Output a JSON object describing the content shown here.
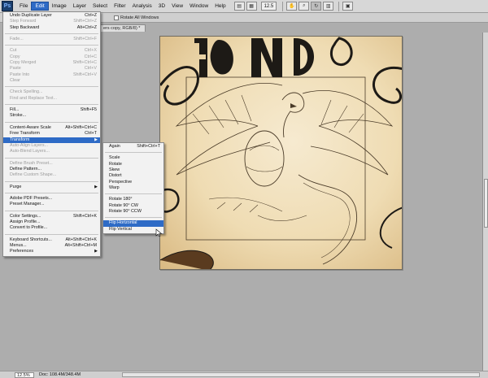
{
  "menubar": {
    "logo": "Ps",
    "items": [
      "File",
      "Edit",
      "Image",
      "Layer",
      "Select",
      "Filter",
      "Analysis",
      "3D",
      "View",
      "Window",
      "Help"
    ],
    "zoom": "12.5"
  },
  "options": {
    "rotate_all_windows": "Rotate All Windows"
  },
  "doc_tab": {
    "title": "ers copy, RGB/8) *"
  },
  "status": {
    "zoom": "12.5%",
    "doc_info": "Doc: 108.4M/348.4M"
  },
  "edit_menu": {
    "rows": [
      {
        "label": "Undo Duplicate Layer",
        "shortcut": "Ctrl+Z",
        "disabled": false
      },
      {
        "label": "Step Forward",
        "shortcut": "Shift+Ctrl+Z",
        "disabled": true
      },
      {
        "label": "Step Backward",
        "shortcut": "Alt+Ctrl+Z",
        "disabled": false
      },
      {
        "sep": true
      },
      {
        "label": "Fade...",
        "shortcut": "Shift+Ctrl+F",
        "disabled": true
      },
      {
        "sep": true
      },
      {
        "label": "Cut",
        "shortcut": "Ctrl+X",
        "disabled": true
      },
      {
        "label": "Copy",
        "shortcut": "Ctrl+C",
        "disabled": true
      },
      {
        "label": "Copy Merged",
        "shortcut": "Shift+Ctrl+C",
        "disabled": true
      },
      {
        "label": "Paste",
        "shortcut": "Ctrl+V",
        "disabled": true
      },
      {
        "label": "Paste Into",
        "shortcut": "Shift+Ctrl+V",
        "disabled": true
      },
      {
        "label": "Clear",
        "shortcut": "",
        "disabled": true
      },
      {
        "sep": true
      },
      {
        "label": "Check Spelling...",
        "shortcut": "",
        "disabled": true
      },
      {
        "label": "Find and Replace Text...",
        "shortcut": "",
        "disabled": true
      },
      {
        "sep": true
      },
      {
        "label": "Fill...",
        "shortcut": "Shift+F5",
        "disabled": false
      },
      {
        "label": "Stroke...",
        "shortcut": "",
        "disabled": false
      },
      {
        "sep": true
      },
      {
        "label": "Content-Aware Scale",
        "shortcut": "Alt+Shift+Ctrl+C",
        "disabled": false
      },
      {
        "label": "Free Transform",
        "shortcut": "Ctrl+T",
        "disabled": false
      },
      {
        "label": "Transform",
        "shortcut": "",
        "submenu": true,
        "highlight": true,
        "disabled": false
      },
      {
        "label": "Auto-Align Layers...",
        "shortcut": "",
        "disabled": true
      },
      {
        "label": "Auto-Blend Layers...",
        "shortcut": "",
        "disabled": true
      },
      {
        "sep": true
      },
      {
        "label": "Define Brush Preset...",
        "shortcut": "",
        "disabled": true
      },
      {
        "label": "Define Pattern...",
        "shortcut": "",
        "disabled": false
      },
      {
        "label": "Define Custom Shape...",
        "shortcut": "",
        "disabled": true
      },
      {
        "sep": true
      },
      {
        "label": "Purge",
        "shortcut": "",
        "submenu": true,
        "disabled": false
      },
      {
        "sep": true
      },
      {
        "label": "Adobe PDF Presets...",
        "shortcut": "",
        "disabled": false
      },
      {
        "label": "Preset Manager...",
        "shortcut": "",
        "disabled": false
      },
      {
        "sep": true
      },
      {
        "label": "Color Settings...",
        "shortcut": "Shift+Ctrl+K",
        "disabled": false
      },
      {
        "label": "Assign Profile...",
        "shortcut": "",
        "disabled": false
      },
      {
        "label": "Convert to Profile...",
        "shortcut": "",
        "disabled": false
      },
      {
        "sep": true
      },
      {
        "label": "Keyboard Shortcuts...",
        "shortcut": "Alt+Shift+Ctrl+K",
        "disabled": false
      },
      {
        "label": "Menus...",
        "shortcut": "Alt+Shift+Ctrl+M",
        "disabled": false
      },
      {
        "label": "Preferences",
        "shortcut": "",
        "submenu": true,
        "disabled": false
      }
    ]
  },
  "transform_menu": {
    "rows": [
      {
        "label": "Again",
        "shortcut": "Shift+Ctrl+T"
      },
      {
        "sep": true
      },
      {
        "label": "Scale"
      },
      {
        "label": "Rotate"
      },
      {
        "label": "Skew"
      },
      {
        "label": "Distort"
      },
      {
        "label": "Perspective"
      },
      {
        "label": "Warp"
      },
      {
        "sep": true
      },
      {
        "label": "Rotate 180°"
      },
      {
        "label": "Rotate 90° CW"
      },
      {
        "label": "Rotate 90° CCW"
      },
      {
        "sep": true
      },
      {
        "label": "Flip Horizontal",
        "highlight": true
      },
      {
        "label": "Flip Vertical"
      }
    ]
  }
}
